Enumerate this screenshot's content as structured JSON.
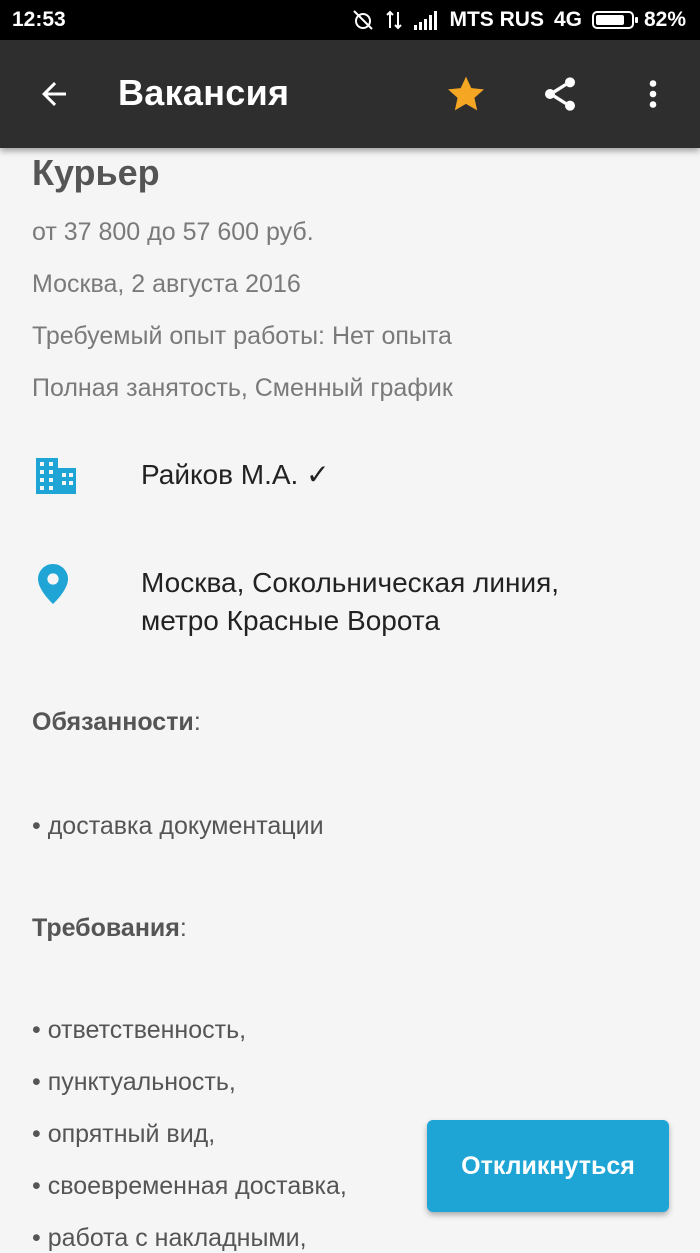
{
  "status_bar": {
    "time": "12:53",
    "carrier": "MTS RUS",
    "network": "4G",
    "battery": "82%",
    "battery_level": 0.82
  },
  "toolbar": {
    "title": "Вакансия",
    "back_icon": "arrow-left-icon",
    "favorite_icon": "star-icon",
    "share_icon": "share-icon",
    "menu_icon": "more-vert-icon",
    "star_color": "#f5a623"
  },
  "vacancy": {
    "title": "Курьер",
    "salary": "от 37 800 до 57 600 руб.",
    "location_date": "Москва, 2 августа 2016",
    "experience": "Требуемый опыт работы: Нет опыта",
    "employment": "Полная занятость, Сменный график",
    "employer": "Райков М.А. ✓",
    "address_line1": "Москва, Сокольническая линия,",
    "address_line2": "метро Красные Ворота",
    "duties_heading": "Обязанности",
    "duties": [
      "• доставка документации"
    ],
    "requirements_heading": "Требования",
    "requirements": [
      "• ответственность,",
      "• пунктуальность,",
      "• опрятный вид,",
      "• своевременная доставка,",
      "• работа с накладными,"
    ],
    "accent_color": "#1ea5d6"
  },
  "actions": {
    "respond_label": "Откликнуться"
  }
}
